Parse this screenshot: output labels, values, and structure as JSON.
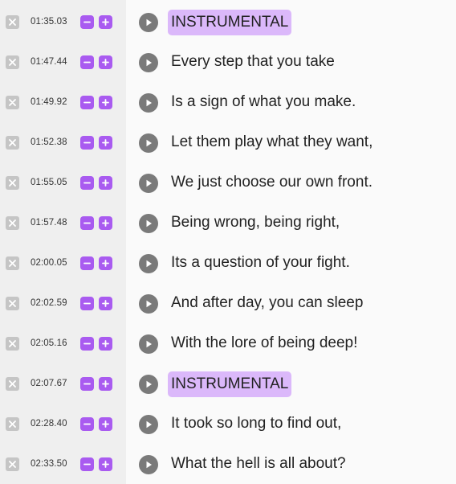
{
  "accent_color": "#a95bf0",
  "tag_highlight_color": "#dbb8fa",
  "icons": {
    "remove": "close-icon",
    "nudge_earlier": "minus-icon",
    "nudge_later": "plus-icon",
    "play": "play-icon"
  },
  "lines": [
    {
      "time": "01:35.03",
      "text": "INSTRUMENTAL",
      "tag": true
    },
    {
      "time": "01:47.44",
      "text": "Every step that you take",
      "tag": false
    },
    {
      "time": "01:49.92",
      "text": "Is a sign of what you make.",
      "tag": false
    },
    {
      "time": "01:52.38",
      "text": "Let them play what they want,",
      "tag": false
    },
    {
      "time": "01:55.05",
      "text": "We just choose our own front.",
      "tag": false
    },
    {
      "time": "01:57.48",
      "text": "Being wrong, being right,",
      "tag": false
    },
    {
      "time": "02:00.05",
      "text": "Its a question of your fight.",
      "tag": false
    },
    {
      "time": "02:02.59",
      "text": "And after day, you can sleep",
      "tag": false
    },
    {
      "time": "02:05.16",
      "text": "With the lore of being deep!",
      "tag": false
    },
    {
      "time": "02:07.67",
      "text": "INSTRUMENTAL",
      "tag": true
    },
    {
      "time": "02:28.40",
      "text": "It took so long to find out,",
      "tag": false
    },
    {
      "time": "02:33.50",
      "text": "What the hell is all about?",
      "tag": false
    }
  ]
}
